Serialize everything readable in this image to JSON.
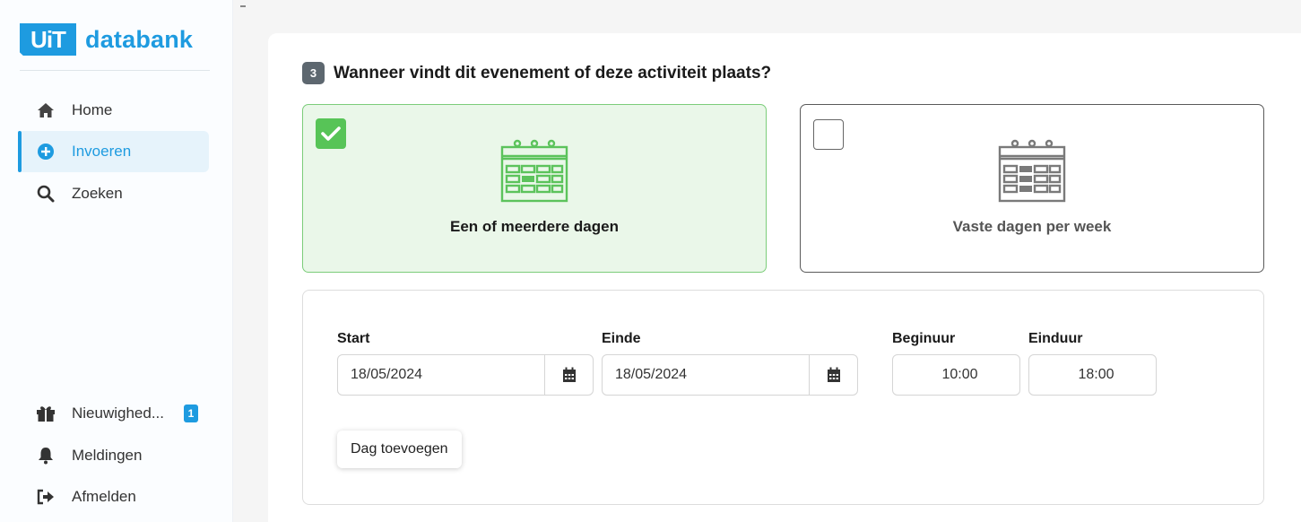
{
  "app": {
    "logo_badge": "UiT",
    "logo_text": "databank",
    "brand_color": "#1e9be0"
  },
  "sidebar": {
    "items": [
      {
        "label": "Home",
        "icon": "home-icon"
      },
      {
        "label": "Invoeren",
        "icon": "plus-circle-icon",
        "active": true
      },
      {
        "label": "Zoeken",
        "icon": "search-icon"
      }
    ],
    "bottom_items": [
      {
        "label": "Nieuwighed...",
        "icon": "gift-icon",
        "badge": "1"
      },
      {
        "label": "Meldingen",
        "icon": "bell-icon"
      },
      {
        "label": "Afmelden",
        "icon": "sign-out-icon"
      }
    ]
  },
  "step": {
    "number": "3",
    "title": "Wanneer vindt dit evenement of deze activiteit plaats?"
  },
  "options": [
    {
      "label": "Een of meerdere dagen",
      "checked": true,
      "icon": "calendar-icon"
    },
    {
      "label": "Vaste dagen per week",
      "checked": false,
      "icon": "calendar-icon"
    }
  ],
  "dates": {
    "start_label": "Start",
    "start_value": "18/05/2024",
    "end_label": "Einde",
    "end_value": "18/05/2024",
    "begin_label": "Beginuur",
    "begin_value": "10:00",
    "end_time_label": "Einduur",
    "end_time_value": "18:00",
    "add_day_label": "Dag toevoegen"
  },
  "colors": {
    "checked_bg": "#eaf7e9",
    "checked_border": "#7ccd7a",
    "check_green": "#57c457",
    "step_badge": "#5d676f"
  }
}
